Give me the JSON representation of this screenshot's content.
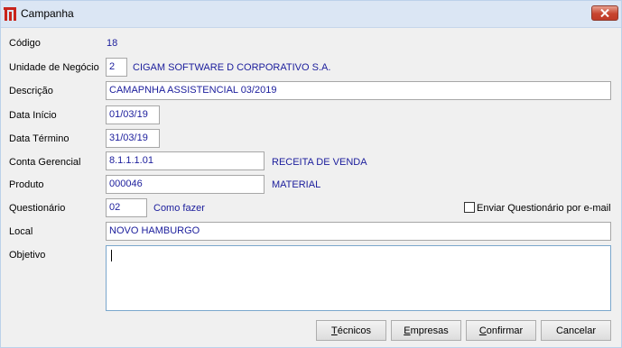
{
  "window": {
    "title": "Campanha"
  },
  "form": {
    "codigo": {
      "label": "Código",
      "value": "18"
    },
    "unidade": {
      "label": "Unidade de Negócio",
      "value": "2",
      "description": "CIGAM SOFTWARE D CORPORATIVO S.A."
    },
    "descricao": {
      "label": "Descrição",
      "value": "CAMAPNHA ASSISTENCIAL 03/2019"
    },
    "data_inicio": {
      "label": "Data Início",
      "value": "01/03/19"
    },
    "data_termino": {
      "label": "Data Término",
      "value": "31/03/19"
    },
    "conta_gerencial": {
      "label": "Conta Gerencial",
      "value": "8.1.1.1.01",
      "description": "RECEITA DE VENDA"
    },
    "produto": {
      "label": "Produto",
      "value": "000046",
      "description": "MATERIAL"
    },
    "questionario": {
      "label": "Questionário",
      "value": "02",
      "description": "Como fazer",
      "checkbox_label": "Enviar Questionário por e-mail",
      "checkbox_checked": false
    },
    "local": {
      "label": "Local",
      "value": "NOVO HAMBURGO"
    },
    "objetivo": {
      "label": "Objetivo",
      "value": ""
    }
  },
  "buttons": {
    "tecnicos": {
      "accel": "T",
      "rest": "écnicos"
    },
    "empresas": {
      "accel": "E",
      "rest": "mpresas"
    },
    "confirmar": {
      "accel": "C",
      "rest": "onfirmar"
    },
    "cancelar": {
      "accel": "",
      "rest": "Cancelar"
    }
  },
  "colors": {
    "value_text": "#1b1d9c",
    "titlebar": "#dbe6f4",
    "close": "#c7452f"
  }
}
